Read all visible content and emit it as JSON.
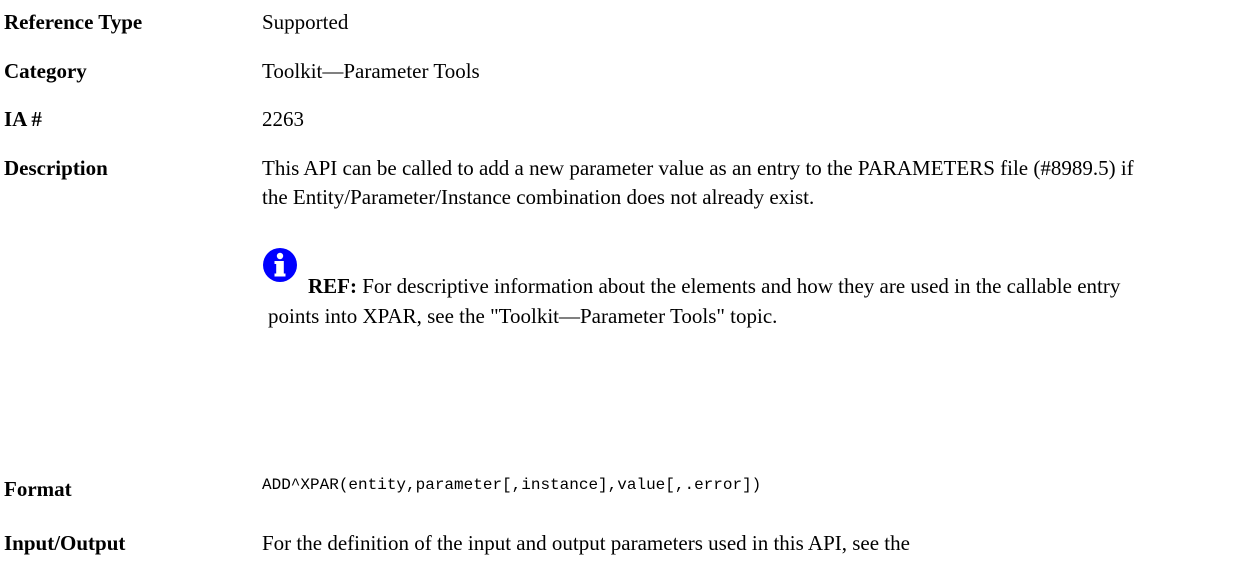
{
  "rows": {
    "reference_type": {
      "label": "Reference Type",
      "value": "Supported"
    },
    "category": {
      "label": "Category",
      "value": "Toolkit—Parameter Tools"
    },
    "ia": {
      "label": "IA #",
      "value": "2263"
    },
    "description": {
      "label": "Description",
      "value": "This API can be called to add a new parameter value as an entry to the PARAMETERS file (#8989.5) if the Entity/Parameter/Instance combination does not already exist."
    },
    "format": {
      "label": "Format",
      "value": "ADD^XPAR(entity,parameter[,instance],value[,.error])"
    },
    "input_output": {
      "label": "Input/Output",
      "value": "For the definition of the input and output parameters used in this API, see the"
    }
  },
  "note": {
    "icon": "info-icon",
    "icon_color": "#0000ff",
    "label": "REF:",
    "text": " For descriptive information about the elements and how they are used in the callable entry points into XPAR, see the \"Toolkit—Parameter Tools\" topic."
  }
}
